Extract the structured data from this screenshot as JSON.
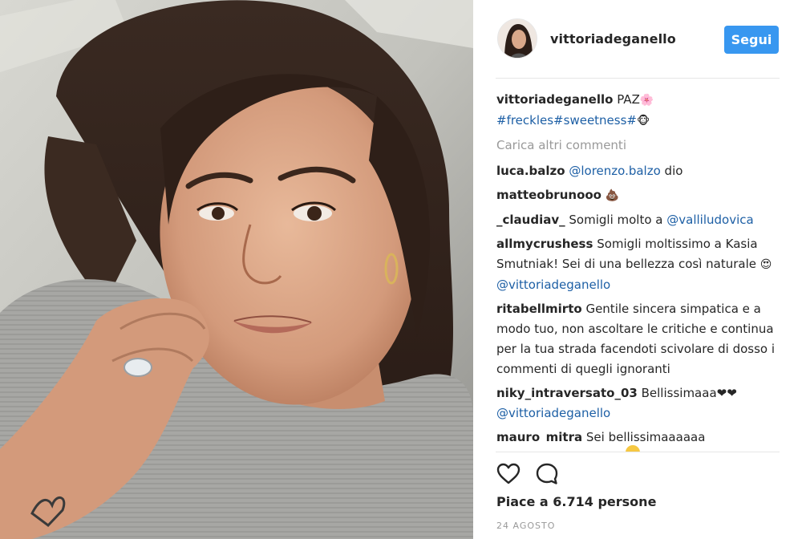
{
  "post": {
    "image_alt": "selfie photo",
    "author": "vittoriadeganello",
    "follow_label": "Segui",
    "caption": {
      "username": "vittoriadeganello",
      "text": "PAZ",
      "text_emoji": "🌸",
      "hashtags": "#freckles#sweetness#",
      "hashtag_emoji": "🐵"
    },
    "load_more": "Carica altri commenti",
    "comments": [
      {
        "username": "luca.balzo",
        "mention": "@lorenzo.balzo",
        "text": "dio"
      },
      {
        "username": "matteobrunooo",
        "text": "💩"
      },
      {
        "username": "_claudiav_",
        "text": "Somigli molto a",
        "mention": "@valliludovica"
      },
      {
        "username": "allmycrushess",
        "text": "Somigli moltissimo a Kasia Smutniak! Sei di una bellezza così naturale",
        "emoji": "😍",
        "mention": "@vittoriadeganello"
      },
      {
        "username": "ritabellmirto",
        "text": "Gentile sincera simpatica e a modo tuo, non ascoltare le critiche e continua per la tua strada facendoti scivolare di dosso i commenti di quegli ignoranti"
      },
      {
        "username": "niky_intraversato_03",
        "text": "Bellissimaaa❤❤",
        "mention": "@vittoriadeganello"
      },
      {
        "username": "mauro_mitra",
        "text": "Sei bellissimaaaaaa"
      }
    ],
    "likes": "Piace a 6.714 persone",
    "date": "24 AGOSTO",
    "icons": {
      "like": "heart-icon",
      "comment": "comment-icon"
    },
    "colors": {
      "accent": "#3897f0",
      "link": "#1d5fa5",
      "muted": "#999999",
      "text": "#262626"
    }
  }
}
